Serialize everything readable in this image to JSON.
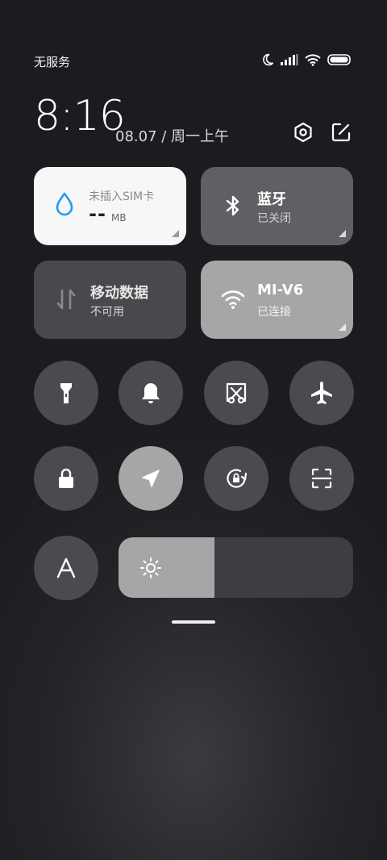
{
  "status_bar": {
    "carrier": "无服务",
    "icons": [
      "moon-icon",
      "signal-icon",
      "wifi-icon",
      "battery-icon"
    ]
  },
  "header": {
    "time": "8:16",
    "date": "08.07 / 周一上午",
    "icons": [
      "settings-icon",
      "edit-icon"
    ]
  },
  "tiles": {
    "data_usage": {
      "title": "未插入SIM卡",
      "value": "--",
      "unit": "MB",
      "state": "on",
      "icon": "water-drop-icon"
    },
    "bluetooth": {
      "title": "蓝牙",
      "subtitle": "已关闭",
      "state": "off",
      "icon": "bluetooth-icon"
    },
    "mobile_data": {
      "title": "移动数据",
      "subtitle": "不可用",
      "state": "disabled",
      "icon": "data-arrows-icon"
    },
    "wifi": {
      "title": "MI-V6",
      "subtitle": "已连接",
      "state": "on",
      "icon": "wifi-icon"
    }
  },
  "toggles": [
    {
      "id": "flashlight",
      "icon": "flashlight-icon",
      "active": false
    },
    {
      "id": "ring",
      "icon": "bell-icon",
      "active": false
    },
    {
      "id": "screenshot",
      "icon": "scissors-icon",
      "active": false
    },
    {
      "id": "airplane",
      "icon": "airplane-icon",
      "active": false
    },
    {
      "id": "lock",
      "icon": "lock-icon",
      "active": false
    },
    {
      "id": "location",
      "icon": "location-arrow-icon",
      "active": true
    },
    {
      "id": "rotation-lock",
      "icon": "rotation-lock-icon",
      "active": false
    },
    {
      "id": "scanner",
      "icon": "scan-icon",
      "active": false
    },
    {
      "id": "font",
      "icon": "font-a-icon",
      "active": false
    }
  ],
  "brightness": {
    "level": 0.41,
    "icon": "sun-icon"
  },
  "colors": {
    "tile_white": "#f7f7f7",
    "tile_dark": "#5f6063",
    "tile_disabled": "#48494c",
    "tile_active": "#a6a6a6",
    "accent_blue": "#1f9cf0",
    "round_bg": "#4a4b4e"
  }
}
